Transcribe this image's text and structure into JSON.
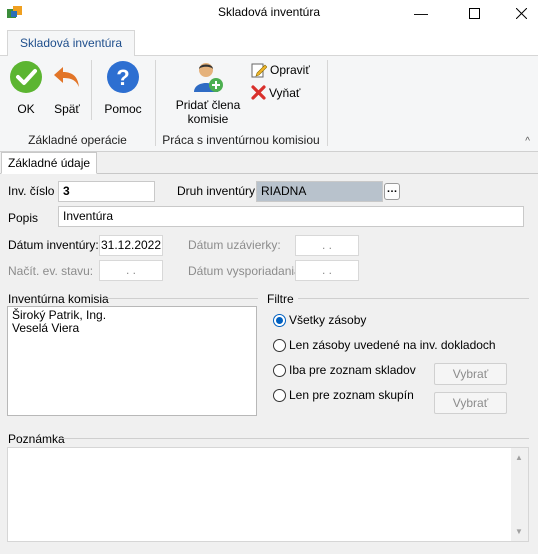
{
  "window": {
    "title": "Skladová inventúra"
  },
  "ribbon": {
    "tab": "Skladová inventúra",
    "buttons": {
      "ok": "OK",
      "back": "Späť",
      "help": "Pomoc",
      "add_member_line1": "Pridať člena",
      "add_member_line2": "komisie",
      "edit": "Opraviť",
      "remove": "Vyňať"
    },
    "groups": {
      "basic": "Základné operácie",
      "commission": "Práca s inventúrnou komisiou"
    }
  },
  "form": {
    "tab": "Základné údaje",
    "inv_no_label": "Inv. číslo",
    "inv_no_value": "3",
    "type_label": "Druh inventúry",
    "type_value": "RIADNA",
    "desc_label": "Popis",
    "desc_value": "Inventúra",
    "inv_date_label": "Dátum inventúry:",
    "inv_date_value": "31.12.2022",
    "close_date_label": "Dátum uzávierky:",
    "close_date_value": ". .",
    "load_state_label": "Načít. ev. stavu:",
    "load_state_value": ". .",
    "settle_date_label": "Dátum vysporiadania:",
    "settle_date_value": ". .",
    "commission_label": "Inventúrna komisia",
    "commission_members": [
      "Široký Patrik, Ing.",
      "Veselá Viera"
    ],
    "filters_label": "Filtre",
    "filters": [
      "Všetky zásoby",
      "Len zásoby uvedené na inv. dokladoch",
      "Iba pre zoznam skladov",
      "Len pre zoznam skupín"
    ],
    "select_label": "Vybrať",
    "notes_label": "Poznámka",
    "notes_value": ""
  },
  "colors": {
    "accent": "#0060c0",
    "ok_green": "#5cb531",
    "help_blue": "#2d6fd1",
    "back_orange": "#e27528"
  }
}
